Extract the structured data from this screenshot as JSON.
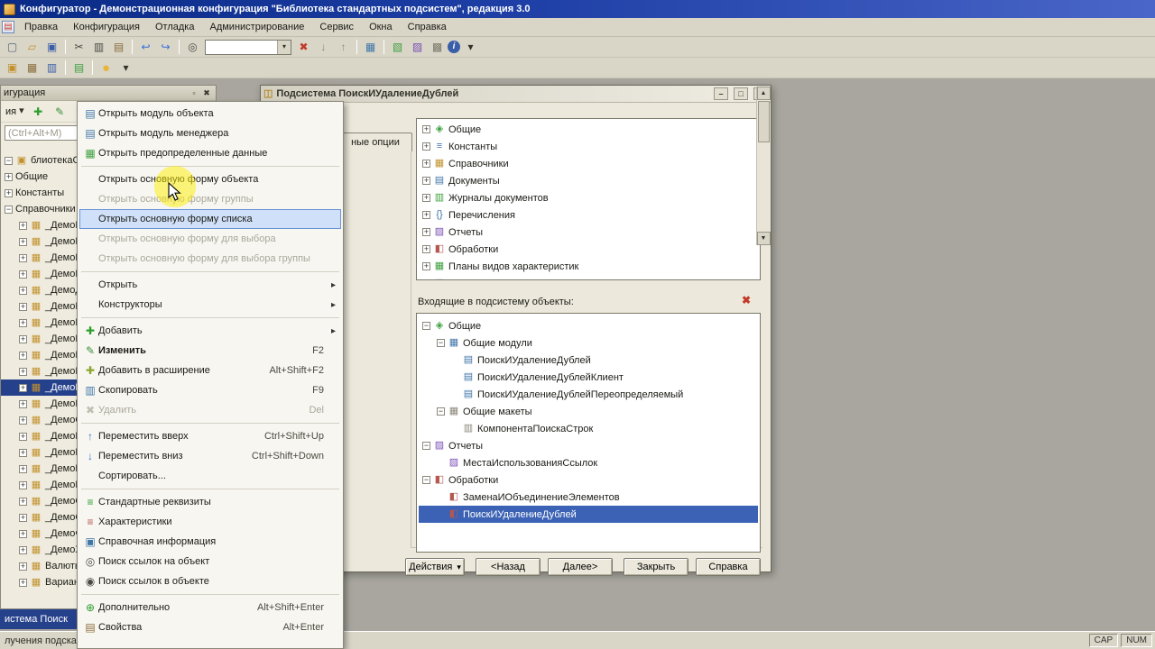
{
  "window": {
    "title": "Конфигуратор - Демонстрационная конфигурация \"Библиотека стандартных подсистем\", редакция 3.0"
  },
  "menu_bar": {
    "items": [
      "Правка",
      "Конфигурация",
      "Отладка",
      "Администрирование",
      "Сервис",
      "Окна",
      "Справка"
    ]
  },
  "find_combo": {
    "value": ""
  },
  "toolbar_main_left": {
    "items": [
      {
        "name": "new-file-icon",
        "glyph": "▢",
        "color": "#56657a"
      },
      {
        "name": "open-file-icon",
        "glyph": "▱",
        "color": "#c2912e"
      },
      {
        "name": "save-icon",
        "glyph": "▣",
        "color": "#3a5fa8"
      },
      {
        "sep": true
      },
      {
        "name": "cut-icon",
        "glyph": "✂",
        "color": "#4a4a42"
      },
      {
        "name": "copy-icon",
        "glyph": "▥",
        "color": "#4a4a42"
      },
      {
        "name": "paste-icon",
        "glyph": "▤",
        "color": "#8a6d3b"
      },
      {
        "sep": true
      },
      {
        "name": "undo-icon",
        "glyph": "↩",
        "color": "#3a6fd8"
      },
      {
        "name": "redo-icon",
        "glyph": "↪",
        "color": "#3a6fd8"
      },
      {
        "sep": true
      },
      {
        "name": "find-icon",
        "glyph": "◎",
        "color": "#4a4a42"
      }
    ]
  },
  "toolbar_main_right": {
    "items": [
      {
        "name": "find-next-icon",
        "glyph": "↓",
        "color": "#8a8a7a"
      },
      {
        "name": "find-previous-icon",
        "glyph": "↑",
        "color": "#8a8a7a"
      },
      {
        "sep": true
      },
      {
        "name": "show-navigation-icon",
        "glyph": "▦",
        "color": "#4076a8"
      },
      {
        "sep": true
      },
      {
        "name": "syntax-check-icon",
        "glyph": "▧",
        "color": "#3fa03f"
      },
      {
        "name": "templates-icon",
        "glyph": "▨",
        "color": "#7a4fb5"
      },
      {
        "name": "calculator-icon",
        "glyph": "▩",
        "color": "#7a7869"
      },
      {
        "name": "info-icon",
        "glyph": "i",
        "color": "#ffffff"
      },
      {
        "name": "toolbar-more-icon",
        "glyph": "▾",
        "color": "#33332a"
      }
    ]
  },
  "toolbar_config": {
    "items": [
      {
        "name": "open-configuration-icon",
        "glyph": "▣",
        "color": "#c2912e"
      },
      {
        "name": "configuration-storage-icon",
        "glyph": "▦",
        "color": "#8a6d3b"
      },
      {
        "name": "compare-configuration-icon",
        "glyph": "▥",
        "color": "#3a5fa8"
      },
      {
        "sep": true
      },
      {
        "name": "update-database-icon",
        "glyph": "▤",
        "color": "#3fa03f"
      },
      {
        "sep": true
      },
      {
        "name": "start-enterprise-icon",
        "glyph": "●",
        "color": "#e8b43a"
      },
      {
        "name": "enterprise-dropdown-icon",
        "glyph": "▾",
        "color": "#33332a"
      }
    ]
  },
  "icons": {
    "window-doc-icon": {
      "glyph": "▤",
      "color": "#c23a2a"
    },
    "combo-caret-icon": {
      "glyph": "▾",
      "color": "#33332a"
    },
    "clear-find-icon": {
      "glyph": "✖",
      "color": "#c23a2a"
    },
    "pin-icon": {
      "glyph": "▫",
      "color": "#3a3a30"
    },
    "panel-close-icon": {
      "glyph": "✖",
      "color": "#3a3a30"
    },
    "actions-caret-icon": {
      "glyph": "▾",
      "color": "#33332a"
    },
    "module-icon": {
      "glyph": "▤",
      "color": "#4076a8"
    },
    "predefined-data-icon": {
      "glyph": "▦",
      "color": "#3fa03f"
    },
    "add-icon": {
      "glyph": "✚",
      "color": "#2d9e2d"
    },
    "edit-icon": {
      "glyph": "✎",
      "color": "#3a8f3a"
    },
    "add-extension-icon": {
      "glyph": "✚",
      "color": "#8aa52d"
    },
    "copy-item-icon": {
      "glyph": "▥",
      "color": "#4076a8"
    },
    "delete-icon": {
      "glyph": "✖",
      "color": "#b0ada0"
    },
    "move-up-icon": {
      "glyph": "↑",
      "color": "#3a6fd8"
    },
    "move-down-icon": {
      "glyph": "↓",
      "color": "#3a6fd8"
    },
    "standard-attributes-icon": {
      "glyph": "≡",
      "color": "#2d9e2d"
    },
    "characteristics-icon": {
      "glyph": "≡",
      "color": "#b5564f"
    },
    "help-info-icon": {
      "glyph": "▣",
      "color": "#4076a8"
    },
    "find-references-icon": {
      "glyph": "◎",
      "color": "#4a4a42"
    },
    "find-in-object-icon": {
      "glyph": "◉",
      "color": "#4a4a42"
    },
    "additional-icon": {
      "glyph": "⊕",
      "color": "#2d9e2d"
    },
    "properties-icon": {
      "glyph": "▤",
      "color": "#8a6d3b"
    },
    "configuration-icon": {
      "glyph": "▣",
      "color": "#c2912e"
    },
    "catalog-icon": {
      "glyph": "▦",
      "color": "#c2912e"
    },
    "common-icon": {
      "glyph": "◈",
      "color": "#3fa03f"
    },
    "constants-icon": {
      "glyph": "≡",
      "color": "#4076a8"
    },
    "document-icon": {
      "glyph": "▤",
      "color": "#4076a8"
    },
    "journal-icon": {
      "glyph": "▥",
      "color": "#3fa03f"
    },
    "enum-icon": {
      "glyph": "{}",
      "color": "#4076a8"
    },
    "report-icon": {
      "glyph": "▨",
      "color": "#7a4fb5"
    },
    "dataprocessor-icon": {
      "glyph": "◧",
      "color": "#b5564f"
    },
    "chart-of-characteristic-types-icon": {
      "glyph": "▦",
      "color": "#3fa03f"
    },
    "exchange-plan-icon": {
      "glyph": "▦",
      "color": "#4076a8"
    },
    "common-modules-icon": {
      "glyph": "▦",
      "color": "#4076a8"
    },
    "common-module-icon": {
      "glyph": "▤",
      "color": "#4076a8"
    },
    "common-templates-icon": {
      "glyph": "▦",
      "color": "#8a8779"
    },
    "template-icon": {
      "glyph": "▥",
      "color": "#8a8779"
    },
    "subsystem-icon": {
      "glyph": "◫",
      "color": "#b58a2e"
    },
    "minimize-icon": {
      "glyph": "–",
      "color": "#33332a"
    },
    "maximize-icon": {
      "glyph": "□",
      "color": "#33332a"
    },
    "dialog-close-icon": {
      "glyph": "×",
      "color": "#33332a"
    },
    "remove-item-icon": {
      "glyph": "✖",
      "color": "#c23a2a"
    },
    "scroll-up-icon": {
      "glyph": "▲",
      "color": "#33332a"
    },
    "scroll-down-icon": {
      "glyph": "▼",
      "color": "#33332a"
    }
  },
  "left_panel": {
    "title": "игурация",
    "actions_label": "ия",
    "search_placeholder": "(Ctrl+Alt+M)",
    "tree": {
      "items": [
        {
          "label": "блиотекаСтанда",
          "icon": "configuration-icon",
          "exp": "minus"
        },
        {
          "label": "Общие",
          "exp": "plus"
        },
        {
          "label": "Константы",
          "exp": "plus"
        },
        {
          "label": "Справочники",
          "exp": "minus"
        },
        {
          "label": "_ДемоБан",
          "icon": "catalog-icon",
          "exp": "plus",
          "indent": 1
        },
        {
          "label": "_ДемоВид",
          "icon": "catalog-icon",
          "exp": "plus",
          "indent": 1
        },
        {
          "label": "_ДемоГру",
          "icon": "catalog-icon",
          "exp": "plus",
          "indent": 1
        },
        {
          "label": "_ДемоГру",
          "icon": "catalog-icon",
          "exp": "plus",
          "indent": 1
        },
        {
          "label": "_ДемоДоп",
          "icon": "catalog-icon",
          "exp": "plus",
          "indent": 1
        },
        {
          "label": "_ДемоКас",
          "icon": "catalog-icon",
          "exp": "plus",
          "indent": 1
        },
        {
          "label": "_ДемоКас",
          "icon": "catalog-icon",
          "exp": "plus",
          "indent": 1
        },
        {
          "label": "_ДемоКон",
          "icon": "catalog-icon",
          "exp": "plus",
          "indent": 1
        },
        {
          "label": "_ДемоКон",
          "icon": "catalog-icon",
          "exp": "plus",
          "indent": 1
        },
        {
          "label": "_ДемоМес",
          "icon": "catalog-icon",
          "exp": "plus",
          "indent": 1
        },
        {
          "label": "_ДемоНом",
          "icon": "catalog-icon",
          "exp": "plus",
          "indent": 1,
          "cls": "selected"
        },
        {
          "label": "_ДемоНом",
          "icon": "catalog-icon",
          "exp": "plus",
          "indent": 1
        },
        {
          "label": "_ДемоОрг",
          "icon": "catalog-icon",
          "exp": "plus",
          "indent": 1
        },
        {
          "label": "_ДемоПар",
          "icon": "catalog-icon",
          "exp": "plus",
          "indent": 1
        },
        {
          "label": "_ДемоПод",
          "icon": "catalog-icon",
          "exp": "plus",
          "indent": 1
        },
        {
          "label": "_ДемоПро",
          "icon": "catalog-icon",
          "exp": "plus",
          "indent": 1
        },
        {
          "label": "_ДемоПро",
          "icon": "catalog-icon",
          "exp": "plus",
          "indent": 1
        },
        {
          "label": "_ДемоСта",
          "icon": "catalog-icon",
          "exp": "plus",
          "indent": 1
        },
        {
          "label": "_ДемоСче",
          "icon": "catalog-icon",
          "exp": "plus",
          "indent": 1
        },
        {
          "label": "_ДемоФиз",
          "icon": "catalog-icon",
          "exp": "plus",
          "indent": 1
        },
        {
          "label": "_ДемоХар",
          "icon": "catalog-icon",
          "exp": "plus",
          "indent": 1
        },
        {
          "label": "Валюты",
          "icon": "catalog-icon",
          "exp": "plus",
          "indent": 1
        },
        {
          "label": "Варианты",
          "icon": "catalog-icon",
          "exp": "plus",
          "indent": 1
        }
      ]
    }
  },
  "context_menu": {
    "items": [
      {
        "label": "Открыть модуль объекта",
        "icon": "module-icon"
      },
      {
        "label": "Открыть модуль менеджера",
        "icon": "module-icon"
      },
      {
        "label": "Открыть предопределенные данные",
        "icon": "predefined-data-icon"
      },
      {
        "sep": true
      },
      {
        "label": "Открыть основную форму объекта"
      },
      {
        "label": "Открыть основную форму группы",
        "cls": "disabled"
      },
      {
        "label": "Открыть основную форму списка",
        "cls": "selected"
      },
      {
        "label": "Открыть основную форму для выбора",
        "cls": "disabled"
      },
      {
        "label": "Открыть основную форму для выбора группы",
        "cls": "disabled"
      },
      {
        "sep": true
      },
      {
        "label": "Открыть",
        "cls": "has-sub"
      },
      {
        "label": "Конструкторы",
        "cls": "has-sub"
      },
      {
        "sep": true
      },
      {
        "label": "Добавить",
        "icon": "add-icon",
        "cls": "has-sub"
      },
      {
        "label": "Изменить",
        "shortcut": "F2",
        "icon": "edit-icon",
        "cls": "bold"
      },
      {
        "label": "Добавить в расширение",
        "shortcut": "Alt+Shift+F2",
        "icon": "add-extension-icon"
      },
      {
        "label": "Скопировать",
        "shortcut": "F9",
        "icon": "copy-item-icon"
      },
      {
        "label": "Удалить",
        "shortcut": "Del",
        "icon": "delete-icon",
        "cls": "disabled"
      },
      {
        "sep": true
      },
      {
        "label": "Переместить вверх",
        "shortcut": "Ctrl+Shift+Up",
        "icon": "move-up-icon"
      },
      {
        "label": "Переместить вниз",
        "shortcut": "Ctrl+Shift+Down",
        "icon": "move-down-icon"
      },
      {
        "label": "Сортировать..."
      },
      {
        "sep": true
      },
      {
        "label": "Стандартные реквизиты",
        "icon": "standard-attributes-icon"
      },
      {
        "label": "Характеристики",
        "icon": "characteristics-icon"
      },
      {
        "label": "Справочная информация",
        "icon": "help-info-icon"
      },
      {
        "label": "Поиск ссылок на объект",
        "icon": "find-references-icon"
      },
      {
        "label": "Поиск ссылок в объекте",
        "icon": "find-in-object-icon"
      },
      {
        "sep": true
      },
      {
        "label": "Дополнительно",
        "shortcut": "Alt+Shift+Enter",
        "icon": "additional-icon"
      },
      {
        "label": "Свойства",
        "shortcut": "Alt+Enter",
        "icon": "properties-icon"
      }
    ]
  },
  "dialog": {
    "title": "Подсистема ПоискИУдалениеДублей",
    "tab_label": "ные опции",
    "metadata_tree": {
      "items": [
        {
          "label": "Общие",
          "icon": "common-icon",
          "exp": "plus"
        },
        {
          "label": "Константы",
          "icon": "constants-icon",
          "exp": "plus"
        },
        {
          "label": "Справочники",
          "icon": "catalog-icon",
          "exp": "plus"
        },
        {
          "label": "Документы",
          "icon": "document-icon",
          "exp": "plus"
        },
        {
          "label": "Журналы документов",
          "icon": "journal-icon",
          "exp": "plus"
        },
        {
          "label": "Перечисления",
          "icon": "enum-icon",
          "exp": "plus"
        },
        {
          "label": "Отчеты",
          "icon": "report-icon",
          "exp": "plus"
        },
        {
          "label": "Обработки",
          "icon": "dataprocessor-icon",
          "exp": "plus"
        },
        {
          "label": "Планы видов характеристик",
          "icon": "chart-of-characteristic-types-icon",
          "exp": "plus"
        },
        {
          "label": "",
          "icon": "exchange-plan-icon",
          "exp": "plus"
        }
      ]
    },
    "included_label": "Входящие в подсистему объекты:",
    "included_tree": {
      "items": [
        {
          "label": "Общие",
          "icon": "common-icon",
          "exp": "minus"
        },
        {
          "label": "Общие модули",
          "icon": "common-modules-icon",
          "exp": "minus",
          "indent": 1
        },
        {
          "label": "ПоискИУдалениеДублей",
          "icon": "common-module-icon",
          "indent": 2
        },
        {
          "label": "ПоискИУдалениеДублейКлиент",
          "icon": "common-module-icon",
          "indent": 2
        },
        {
          "label": "ПоискИУдалениеДублейПереопределяемый",
          "icon": "common-module-icon",
          "indent": 2
        },
        {
          "label": "Общие макеты",
          "icon": "common-templates-icon",
          "exp": "minus",
          "indent": 1
        },
        {
          "label": "КомпонентаПоискаСтрок",
          "icon": "template-icon",
          "indent": 2
        },
        {
          "label": "Отчеты",
          "icon": "report-icon",
          "exp": "minus"
        },
        {
          "label": "МестаИспользованияСсылок",
          "icon": "report-icon",
          "indent": 1
        },
        {
          "label": "Обработки",
          "icon": "dataprocessor-icon",
          "exp": "minus"
        },
        {
          "label": "ЗаменаИОбъединениеЭлементов",
          "icon": "dataprocessor-icon",
          "indent": 1
        },
        {
          "label": "ПоискИУдалениеДублей",
          "icon": "dataprocessor-icon",
          "indent": 1,
          "cls": "selected"
        }
      ]
    },
    "buttons": {
      "items": [
        {
          "label": "Действия",
          "cls": "dropdown"
        },
        {
          "label": "<Назад"
        },
        {
          "label": "Далее>"
        },
        {
          "label": "Закрыть"
        },
        {
          "label": "Справка"
        }
      ]
    }
  },
  "docked_panel": {
    "label": "истема Поиск"
  },
  "status_bar": {
    "hint": "лучения подсказ",
    "cap": "CAP",
    "num": "NUM"
  }
}
